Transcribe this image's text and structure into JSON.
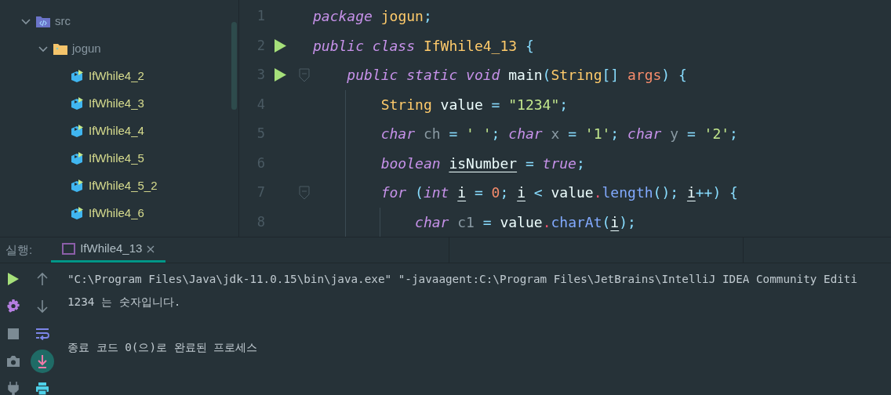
{
  "project_tree": [
    {
      "label": "src",
      "kind": "source-folder",
      "expanded": true,
      "children": [
        {
          "label": "jogun",
          "kind": "package",
          "expanded": true,
          "children": [
            {
              "label": "IfWhile4_2",
              "kind": "class"
            },
            {
              "label": "IfWhile4_3",
              "kind": "class"
            },
            {
              "label": "IfWhile4_4",
              "kind": "class"
            },
            {
              "label": "IfWhile4_5",
              "kind": "class"
            },
            {
              "label": "IfWhile4_5_2",
              "kind": "class"
            },
            {
              "label": "IfWhile4_6",
              "kind": "class"
            }
          ]
        }
      ]
    }
  ],
  "editor": {
    "lines": [
      {
        "number": "1",
        "run": false,
        "fold": false,
        "tokens": [
          {
            "text": "package ",
            "kind": "keyword"
          },
          {
            "text": "jogun",
            "kind": "type"
          },
          {
            "text": ";",
            "kind": "punct"
          }
        ]
      },
      {
        "number": "2",
        "run": true,
        "fold": false,
        "tokens": [
          {
            "text": "public class ",
            "kind": "keyword"
          },
          {
            "text": "IfWhile4_13",
            "kind": "type"
          },
          {
            "text": " {",
            "kind": "punct"
          }
        ]
      },
      {
        "number": "3",
        "run": true,
        "fold": true,
        "tokens": [
          {
            "text": "    public static void ",
            "kind": "keyword"
          },
          {
            "text": "main",
            "kind": "plain"
          },
          {
            "text": "(",
            "kind": "punct"
          },
          {
            "text": "String",
            "kind": "type"
          },
          {
            "text": "[] ",
            "kind": "punct"
          },
          {
            "text": "args",
            "kind": "param"
          },
          {
            "text": ") {",
            "kind": "punct"
          }
        ]
      },
      {
        "number": "4",
        "run": false,
        "fold": false,
        "tokens": [
          {
            "text": "        String ",
            "kind": "type"
          },
          {
            "text": "value",
            "kind": "plain"
          },
          {
            "text": " = ",
            "kind": "punct"
          },
          {
            "text": "\"1234\"",
            "kind": "string"
          },
          {
            "text": ";",
            "kind": "punct"
          }
        ]
      },
      {
        "number": "5",
        "run": false,
        "fold": false,
        "tokens": [
          {
            "text": "        char ",
            "kind": "keyword"
          },
          {
            "text": "ch",
            "kind": "unused"
          },
          {
            "text": " = ",
            "kind": "punct"
          },
          {
            "text": "' '",
            "kind": "string"
          },
          {
            "text": "; ",
            "kind": "punct"
          },
          {
            "text": "char ",
            "kind": "keyword"
          },
          {
            "text": "x",
            "kind": "unused"
          },
          {
            "text": " = ",
            "kind": "punct"
          },
          {
            "text": "'1'",
            "kind": "string"
          },
          {
            "text": "; ",
            "kind": "punct"
          },
          {
            "text": "char ",
            "kind": "keyword"
          },
          {
            "text": "y",
            "kind": "unused"
          },
          {
            "text": " = ",
            "kind": "punct"
          },
          {
            "text": "'2'",
            "kind": "string"
          },
          {
            "text": ";",
            "kind": "punct"
          }
        ]
      },
      {
        "number": "6",
        "run": false,
        "fold": false,
        "tokens": [
          {
            "text": "        boolean ",
            "kind": "keyword"
          },
          {
            "text": "isNumber",
            "kind": "reassigned"
          },
          {
            "text": " = ",
            "kind": "punct"
          },
          {
            "text": "true",
            "kind": "keyword"
          },
          {
            "text": ";",
            "kind": "punct"
          }
        ]
      },
      {
        "number": "7",
        "run": false,
        "fold": true,
        "tokens": [
          {
            "text": "        for ",
            "kind": "keyword"
          },
          {
            "text": "(",
            "kind": "punct"
          },
          {
            "text": "int ",
            "kind": "keyword"
          },
          {
            "text": "i",
            "kind": "reassigned"
          },
          {
            "text": " = ",
            "kind": "punct"
          },
          {
            "text": "0",
            "kind": "number"
          },
          {
            "text": "; ",
            "kind": "punct"
          },
          {
            "text": "i",
            "kind": "reassigned"
          },
          {
            "text": " < ",
            "kind": "punct"
          },
          {
            "text": "value",
            "kind": "plain"
          },
          {
            "text": ".",
            "kind": "dot"
          },
          {
            "text": "length",
            "kind": "method"
          },
          {
            "text": "(); ",
            "kind": "punct"
          },
          {
            "text": "i",
            "kind": "reassigned"
          },
          {
            "text": "++) {",
            "kind": "punct"
          }
        ]
      },
      {
        "number": "8",
        "run": false,
        "fold": false,
        "tokens": [
          {
            "text": "            char ",
            "kind": "keyword"
          },
          {
            "text": "c1",
            "kind": "unused"
          },
          {
            "text": " = ",
            "kind": "punct"
          },
          {
            "text": "value",
            "kind": "plain"
          },
          {
            "text": ".",
            "kind": "dot"
          },
          {
            "text": "charAt",
            "kind": "method"
          },
          {
            "text": "(",
            "kind": "punct"
          },
          {
            "text": "i",
            "kind": "reassigned"
          },
          {
            "text": ");",
            "kind": "punct"
          }
        ]
      }
    ]
  },
  "run_panel": {
    "label": "실행:",
    "tabs": [
      {
        "label": "IfWhile4_13",
        "selected": true
      }
    ],
    "toolbar": [
      {
        "kind": "run",
        "selected": false
      },
      {
        "kind": "up",
        "selected": false
      },
      {
        "kind": "settings",
        "selected": false
      },
      {
        "kind": "down",
        "selected": false
      },
      {
        "kind": "stop",
        "selected": false
      },
      {
        "kind": "wrap",
        "selected": false
      },
      {
        "kind": "camera",
        "selected": false
      },
      {
        "kind": "scroll-end",
        "selected": true
      },
      {
        "kind": "plug",
        "selected": false
      },
      {
        "kind": "print",
        "selected": false
      }
    ],
    "console": [
      "\"C:\\Program Files\\Java\\jdk-11.0.15\\bin\\java.exe\" \"-javaagent:C:\\Program Files\\JetBrains\\IntelliJ IDEA Community Editi",
      "1234 는 숫자입니다."
    ],
    "exit_message": "종료 코드 0(으)로 완료된 프로세스"
  }
}
